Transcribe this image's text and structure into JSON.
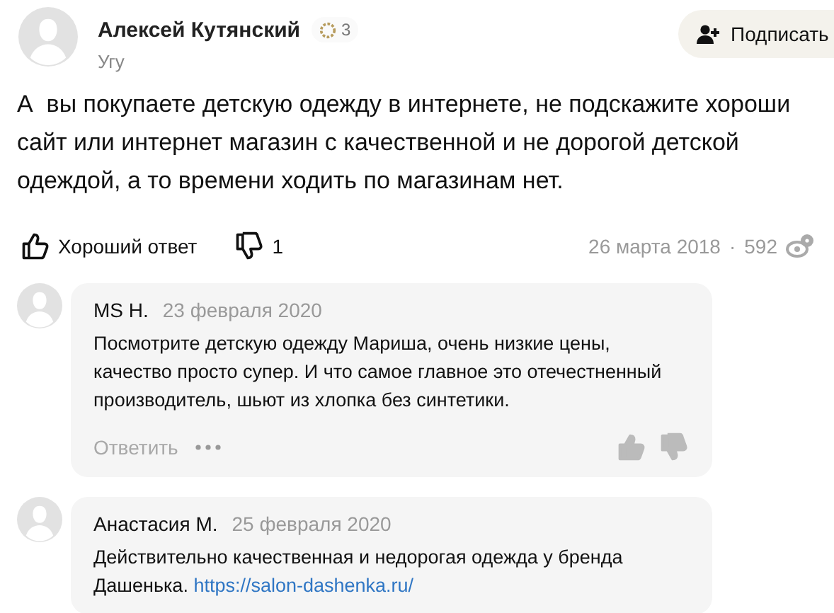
{
  "author": {
    "name": "Алексей Кутянский",
    "rating": "3",
    "status": "Угу"
  },
  "subscribe_button": "Подписать",
  "question": "А  вы покупаете детскую одежду в интернете, не подскажите хороши\nсайт или интернет магазин с качественной и не дорогой детской\nодеждой, а то времени ходить по магазинам нет.",
  "actions": {
    "like_label": "Хороший ответ",
    "dislike_count": "1",
    "date": "26 марта 2018",
    "separator": "·",
    "views": "592"
  },
  "comments": [
    {
      "name": "MS H.",
      "date": "23 февраля 2020",
      "text": "Посмотрите детскую одежду Мариша, очень низкие цены,\nкачество просто супер. И что самое главное это отечестненный\nпроизводитель, шьют из хлопка без синтетики.",
      "reply": "Ответить"
    },
    {
      "name": "Анастасия М.",
      "date": "25 февраля 2020",
      "text": "Действительно качественная и недорогая одежда у бренда\nДашенька. ",
      "link": "https://salon-dashenka.ru/"
    }
  ]
}
